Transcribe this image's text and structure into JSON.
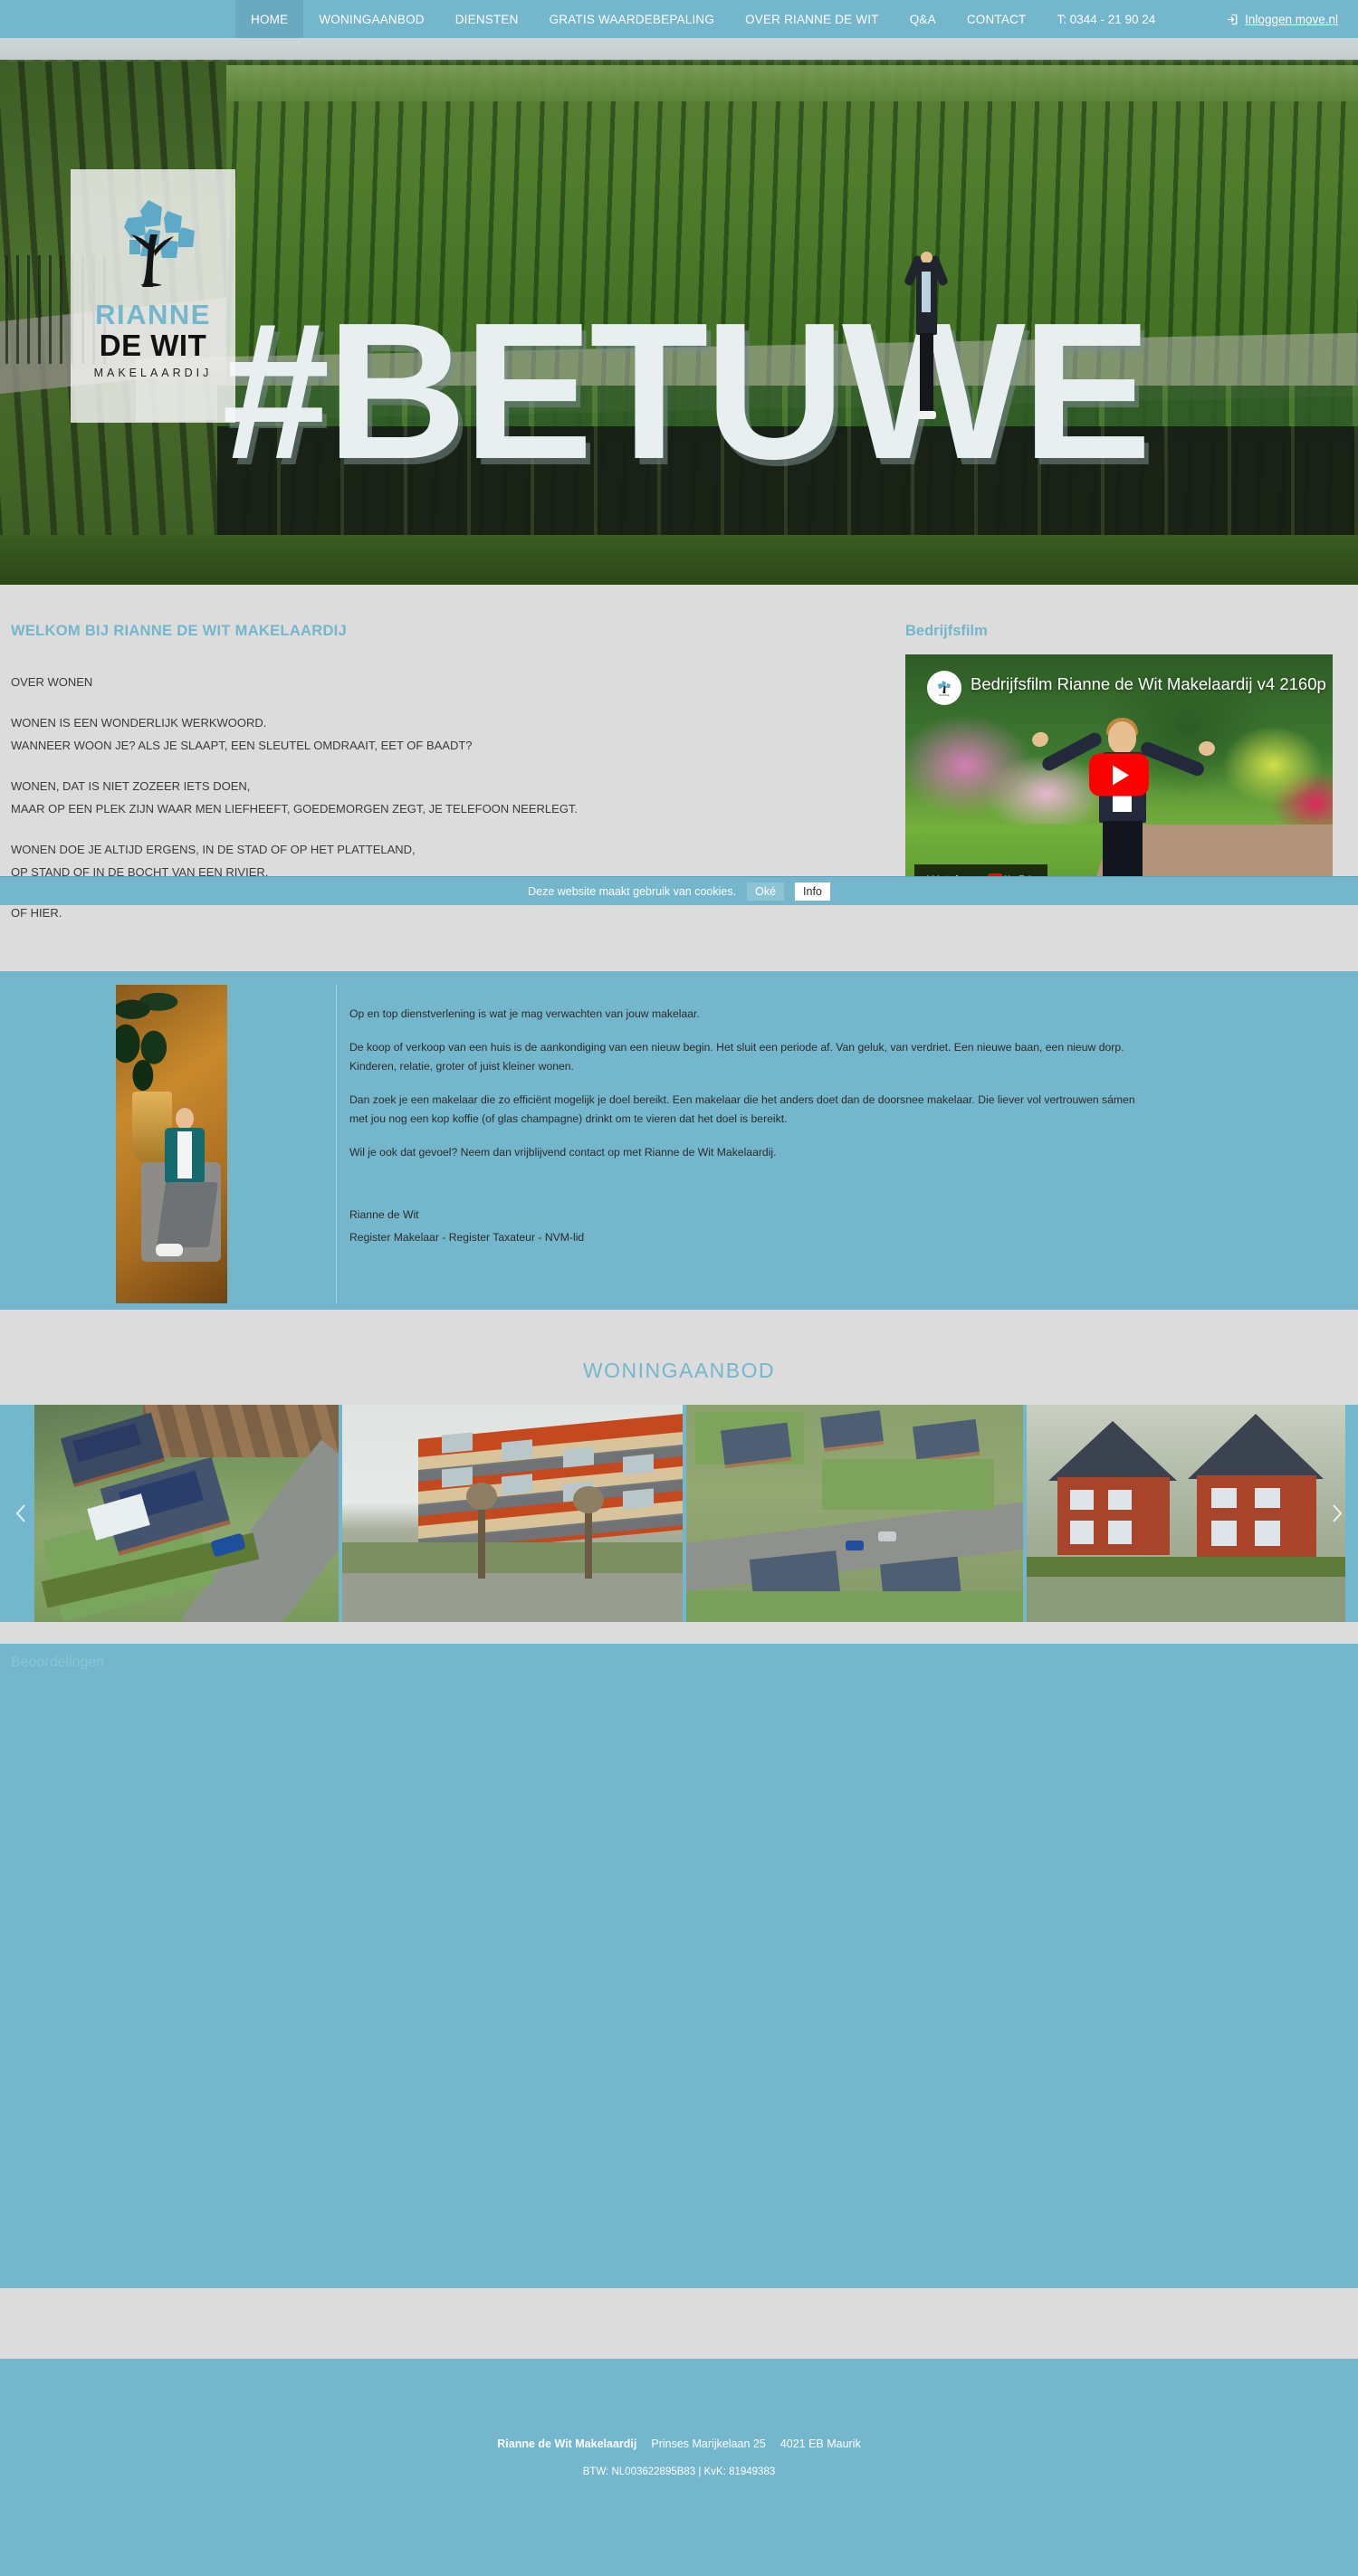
{
  "nav": {
    "items": [
      {
        "label": "HOME",
        "active": true
      },
      {
        "label": "WONINGAANBOD",
        "active": false
      },
      {
        "label": "DIENSTEN",
        "active": false
      },
      {
        "label": "GRATIS WAARDEBEPALING",
        "active": false
      },
      {
        "label": "OVER RIANNE DE WIT",
        "active": false
      },
      {
        "label": "Q&A",
        "active": false
      },
      {
        "label": "CONTACT",
        "active": false
      }
    ],
    "phone": "T: 0344 - 21 90 24",
    "login_label": "Inloggen move.nl",
    "login_icon": "sign-in-icon"
  },
  "logo": {
    "name": "RIANNE",
    "surname": "DE WIT",
    "tagline": "MAKELAARDIJ",
    "icon": "tree-icon"
  },
  "hero": {
    "headline": "#BETUWE"
  },
  "welcome": {
    "title": "WELKOM BIJ RIANNE DE WIT MAKELAARDIJ",
    "paragraphs": [
      "OVER WONEN",
      "WONEN IS EEN WONDERLIJK WERKWOORD.\nWANNEER WOON JE? ALS JE SLAAPT, EEN SLEUTEL OMDRAAIT, EET OF BAADT?",
      "WONEN, DAT IS NIET ZOZEER IETS DOEN,\nMAAR OP EEN PLEK ZIJN WAAR MEN LIEFHEEFT, GOEDEMORGEN ZEGT, JE TELEFOON NEERLEGT.",
      "WONEN DOE JE ALTIJD ERGENS, IN DE STAD OF OP HET PLATTELAND,\nOP STAND OF IN DE BOCHT VAN EEN RIVIER.",
      "OF HIER."
    ]
  },
  "video": {
    "section_title": "Bedrijfsfilm",
    "title": "Bedrijfsfilm Rianne de Wit Makelaardij v4 2160p",
    "watch_label": "Watch on",
    "provider": "YouTube",
    "play_icon": "youtube-play-icon",
    "avatar_icon": "channel-avatar-icon"
  },
  "cookie": {
    "text": "Deze website maakt gebruik van cookies.",
    "accept_label": "Oké",
    "info_label": "Info"
  },
  "about": {
    "paragraphs": [
      "Op en top dienstverlening is wat je mag verwachten van jouw makelaar.",
      "De koop of verkoop van een huis is de aankondiging van een nieuw begin. Het sluit een periode af. Van geluk, van verdriet. Een nieuwe baan, een nieuw dorp.\nKinderen, relatie, groter of juist kleiner wonen.",
      "Dan zoek je een makelaar die zo efficiënt mogelijk je doel bereikt. Een makelaar die het anders doet dan de doorsnee makelaar. Die liever vol vertrouwen sámen\nmet jou nog een kop koffie (of glas champagne) drinkt om te vieren dat het doel is bereikt.",
      "Wil je ook dat gevoel? Neem dan vrijblijvend contact op met Rianne de Wit Makelaardij."
    ],
    "signature_name": "Rianne de Wit",
    "signature_role": "Register Makelaar - Register Taxateur - NVM-lid",
    "portrait_alt": "Rianne de Wit portret"
  },
  "listings": {
    "heading": "WONINGAANBOD",
    "prev_icon": "chevron-left-icon",
    "next_icon": "chevron-right-icon",
    "slides": [
      {
        "alt": "Luchtfoto vrijstaande woning met zonnepanelen"
      },
      {
        "alt": "Appartementencomplex rode baksteen"
      },
      {
        "alt": "Luchtfoto woonwijk met bungalows"
      },
      {
        "alt": "Twee-onder-een-kapwoningen rode baksteen"
      }
    ]
  },
  "reviews": {
    "heading": "Beoordelingen"
  },
  "footer": {
    "company": "Rianne de Wit Makelaardij",
    "street": "Prinses Marijkelaan 25",
    "city": "4021 EB Maurik",
    "legal": "BTW: NL003622895B83 | KvK: 81949383"
  },
  "colors": {
    "brand_teal": "#74b6cc",
    "band_grey": "#dcdcdc",
    "nav_active": "#6aa9c0",
    "heading_teal": "#74b6cc",
    "youtube_red": "#ff0000"
  }
}
